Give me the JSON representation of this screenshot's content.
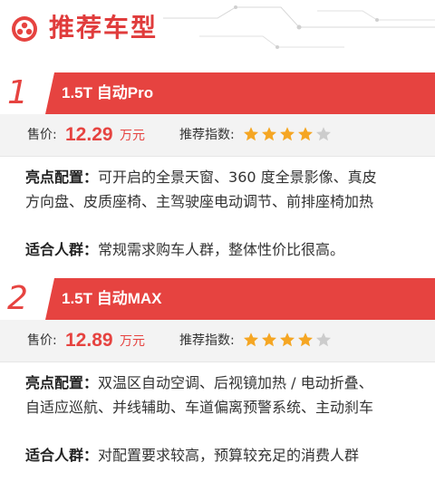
{
  "header": {
    "title": "推荐车型",
    "accent": "#e64340"
  },
  "models": [
    {
      "number": "1",
      "name": "1.5T 自动Pro",
      "price_label": "售价:",
      "price": "12.29",
      "price_unit": "万元",
      "rating_label": "推荐指数:",
      "rating": 4,
      "rating_max": 5,
      "features_label": "亮点配置",
      "features_line1": "可开启的全景天窗、360 度全景影像、真皮",
      "features_line2": "方向盘、皮质座椅、主驾驶座电动调节、前排座椅加热",
      "audience_label": "适合人群",
      "audience": "常规需求购车人群，整体性价比很高。"
    },
    {
      "number": "2",
      "name": "1.5T 自动MAX",
      "price_label": "售价:",
      "price": "12.89",
      "price_unit": "万元",
      "rating_label": "推荐指数:",
      "rating": 4,
      "rating_max": 5,
      "features_label": "亮点配置",
      "features_line1": "双温区自动空调、后视镜加热 / 电动折叠、",
      "features_line2": "自适应巡航、并线辅助、车道偏离预警系统、主动刹车",
      "audience_label": "适合人群",
      "audience": "对配置要求较高，预算较充足的消费人群"
    }
  ],
  "colors": {
    "star_on": "#f5a623",
    "star_off": "#cccccc"
  }
}
